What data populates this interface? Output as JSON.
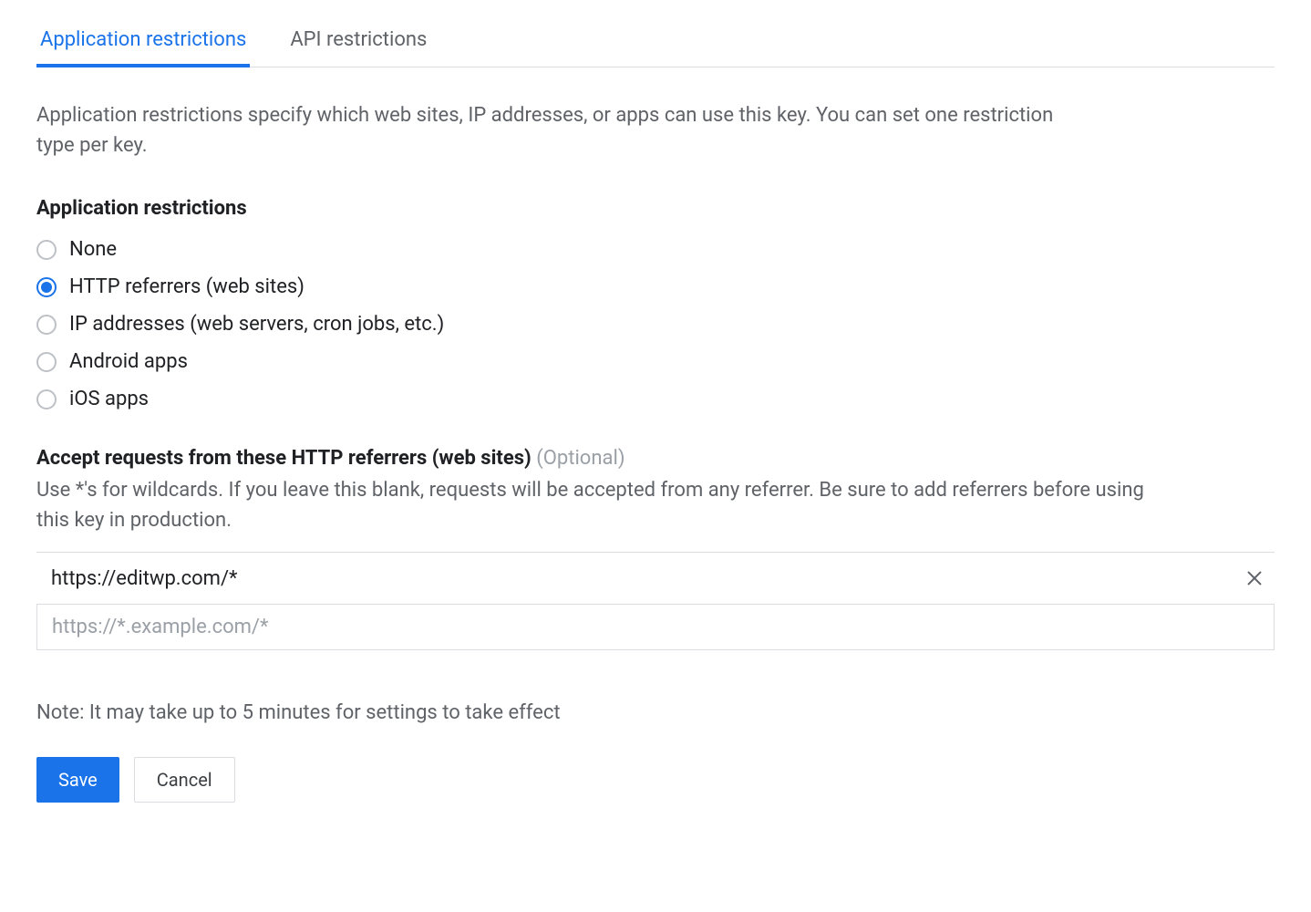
{
  "tabs": {
    "application": "Application restrictions",
    "api": "API restrictions"
  },
  "description": "Application restrictions specify which web sites, IP addresses, or apps can use this key. You can set one restriction type per key.",
  "section_heading": "Application restrictions",
  "radio_options": {
    "none": "None",
    "http": "HTTP referrers (web sites)",
    "ip": "IP addresses (web servers, cron jobs, etc.)",
    "android": "Android apps",
    "ios": "iOS apps"
  },
  "referrers": {
    "heading": "Accept requests from these HTTP referrers (web sites)",
    "optional": "(Optional)",
    "desc": "Use *'s for wildcards. If you leave this blank, requests will be accepted from any referrer. Be sure to add referrers before using this key in production.",
    "items": [
      "https://editwp.com/*"
    ],
    "placeholder": "https://*.example.com/*"
  },
  "note": "Note: It may take up to 5 minutes for settings to take effect",
  "buttons": {
    "save": "Save",
    "cancel": "Cancel"
  }
}
